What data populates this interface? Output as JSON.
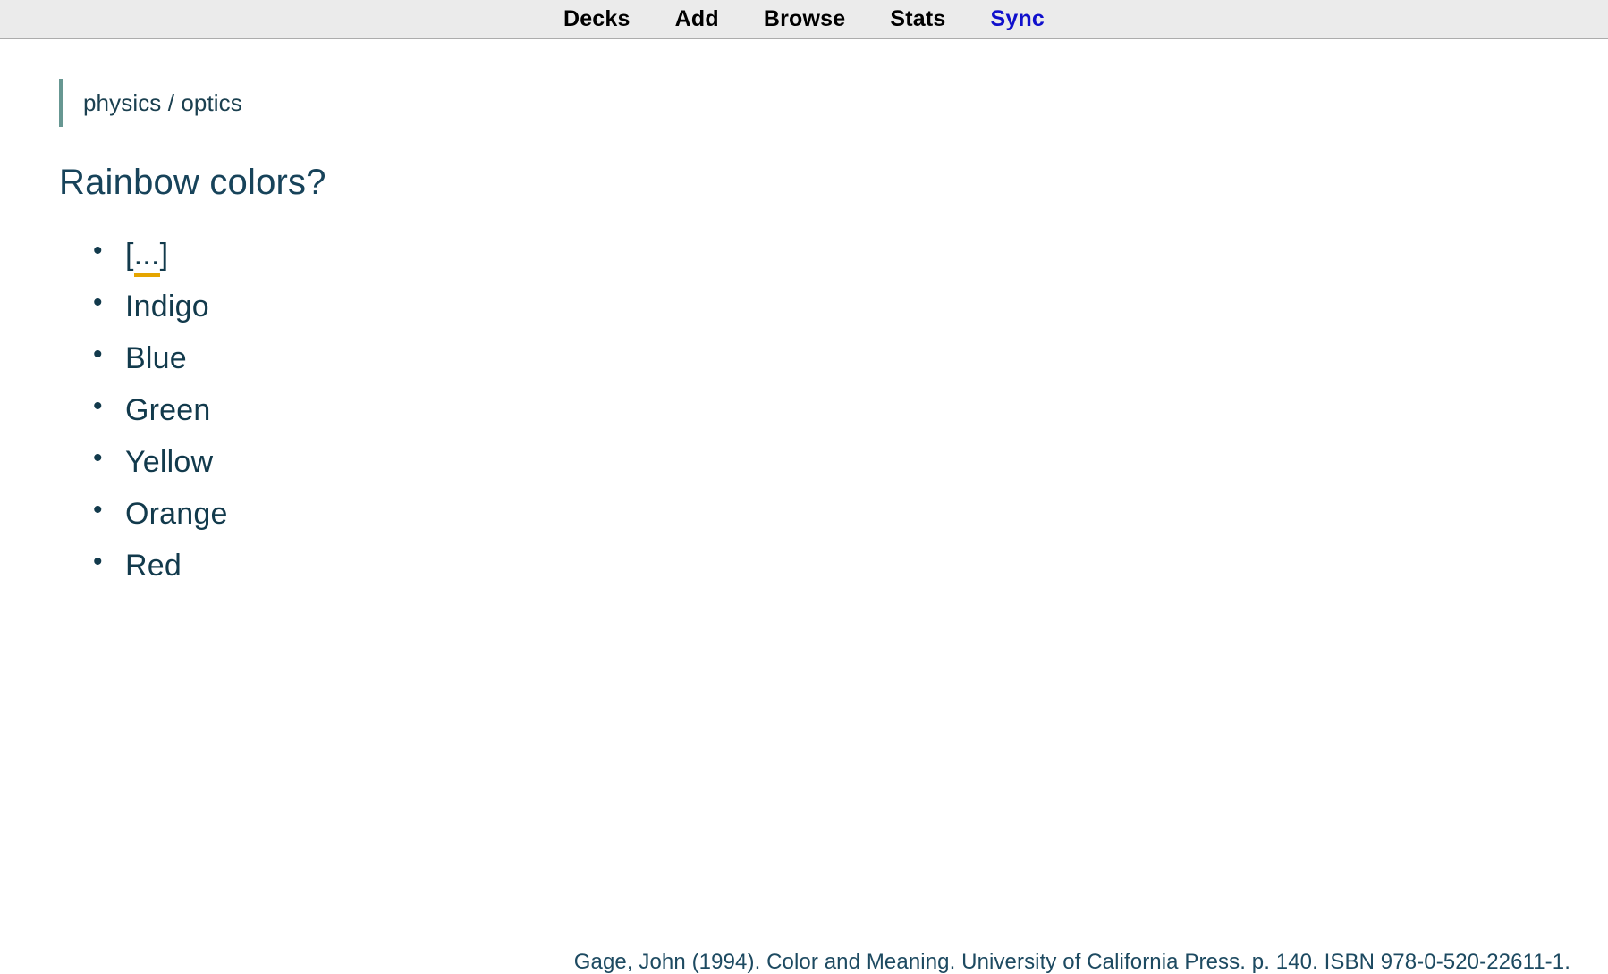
{
  "colors": {
    "nav_background": "#ebebeb",
    "nav_border": "#acacac",
    "nav_text": "#000000",
    "nav_accent": "#1010cc",
    "deck_bar": "#679792",
    "text": "#123a4c",
    "cloze_underline": "#e5a500",
    "page_background": "#ffffff"
  },
  "nav": {
    "items": [
      {
        "label": "Decks",
        "name": "nav-decks",
        "accent": false
      },
      {
        "label": "Add",
        "name": "nav-add",
        "accent": false
      },
      {
        "label": "Browse",
        "name": "nav-browse",
        "accent": false
      },
      {
        "label": "Stats",
        "name": "nav-stats",
        "accent": false
      },
      {
        "label": "Sync",
        "name": "nav-sync",
        "accent": true
      }
    ]
  },
  "card": {
    "deck": "physics / optics",
    "title": "Rainbow colors?",
    "list": [
      {
        "label": "[...]",
        "cloze": true
      },
      {
        "label": "Indigo",
        "cloze": false
      },
      {
        "label": "Blue",
        "cloze": false
      },
      {
        "label": "Green",
        "cloze": false
      },
      {
        "label": "Yellow",
        "cloze": false
      },
      {
        "label": "Orange",
        "cloze": false
      },
      {
        "label": "Red",
        "cloze": false
      }
    ],
    "cloze_parts": {
      "open": "[",
      "dots": "...",
      "close": "]"
    },
    "citation": "Gage, John (1994). Color and Meaning. University of California Press. p. 140. ISBN 978-0-520-22611-1."
  }
}
